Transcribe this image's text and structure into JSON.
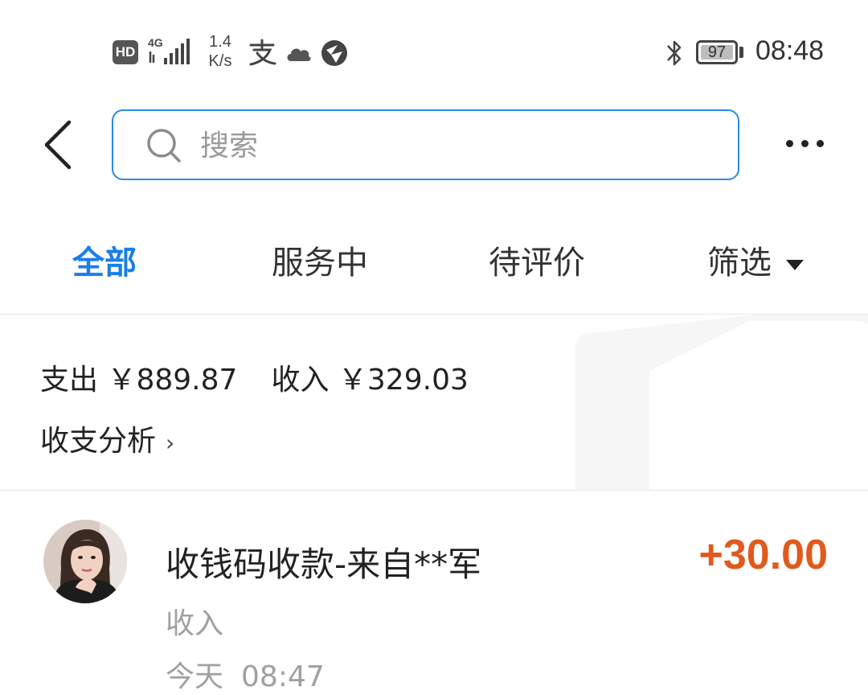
{
  "status_bar": {
    "hd_label": "HD",
    "net_type": "4G",
    "speed_value": "1.4",
    "speed_unit": "K/s",
    "battery_level": "97",
    "time": "08:48",
    "icons": [
      "hd-badge",
      "signal-icon",
      "alipay-icon",
      "cloud-icon",
      "browser-icon",
      "bluetooth-icon",
      "battery-icon"
    ]
  },
  "search": {
    "placeholder": "搜索",
    "value": "",
    "accent": "#2b8be6"
  },
  "tabs": [
    {
      "label": "全部",
      "active": true
    },
    {
      "label": "服务中",
      "active": false
    },
    {
      "label": "待评价",
      "active": false
    },
    {
      "label": "筛选",
      "active": false
    }
  ],
  "summary": {
    "expense_label": "支出",
    "expense_value": "￥889.87",
    "income_label": "收入",
    "income_value": "￥329.03",
    "analysis_label": "收支分析",
    "analysis_chevron": "›"
  },
  "transactions": [
    {
      "title": "收钱码收款-来自**军",
      "amount": "+30.00",
      "type": "收入",
      "date": "今天",
      "time": "08:47",
      "amount_color": "#e05a1e"
    }
  ],
  "colors": {
    "active_tab": "#1a7ee6",
    "muted_text": "#a0a0a0",
    "income_amount": "#e05a1e"
  }
}
